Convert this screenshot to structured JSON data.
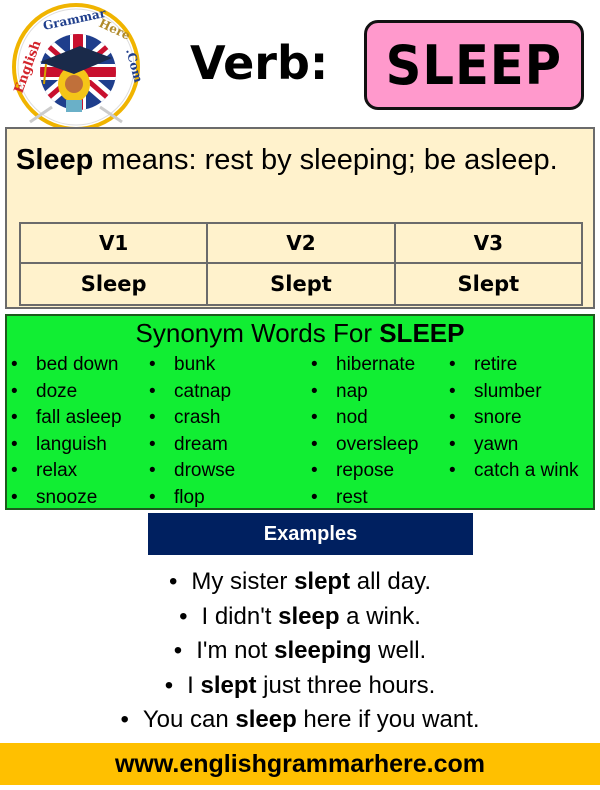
{
  "logo": {
    "text_english": "English",
    "text_grammar": "Grammar",
    "text_here": "Here",
    "text_com": ".Com"
  },
  "header": {
    "verb_label": "Verb:",
    "verb": "SLEEP"
  },
  "definition": {
    "word": "Sleep",
    "rest": " means: rest by sleeping; be asleep."
  },
  "forms": {
    "headers": [
      "V1",
      "V2",
      "V3"
    ],
    "values": [
      "Sleep",
      "Slept",
      "Slept"
    ]
  },
  "synonyms": {
    "title_prefix": "Synonym Words For ",
    "title_word": "SLEEP",
    "columns": [
      [
        "bed down",
        "doze",
        "fall asleep",
        "languish",
        "relax",
        "snooze"
      ],
      [
        "bunk",
        "catnap",
        "crash",
        "dream",
        "drowse",
        "flop"
      ],
      [
        "hibernate",
        "nap",
        "nod",
        "oversleep",
        "repose",
        "rest"
      ],
      [
        "retire",
        "slumber",
        "snore",
        "yawn",
        "catch a wink"
      ]
    ]
  },
  "examples": {
    "title": "Examples",
    "items": [
      {
        "before": "My sister ",
        "bold": "slept",
        "after": " all day."
      },
      {
        "before": "I didn't ",
        "bold": "sleep",
        "after": " a wink."
      },
      {
        "before": "I'm not ",
        "bold": "sleeping",
        "after": " well."
      },
      {
        "before": "I ",
        "bold": "slept",
        "after": " just three hours."
      },
      {
        "before": "You can ",
        "bold": "sleep",
        "after": " here if you want."
      }
    ]
  },
  "footer": {
    "url": "www.englishgrammarhere.com"
  },
  "colors": {
    "badge": "#ff99cc",
    "definition_bg": "#fff2cc",
    "synonyms_bg": "#11ee33",
    "examples_header": "#002060",
    "footer_bg": "#ffc000"
  }
}
